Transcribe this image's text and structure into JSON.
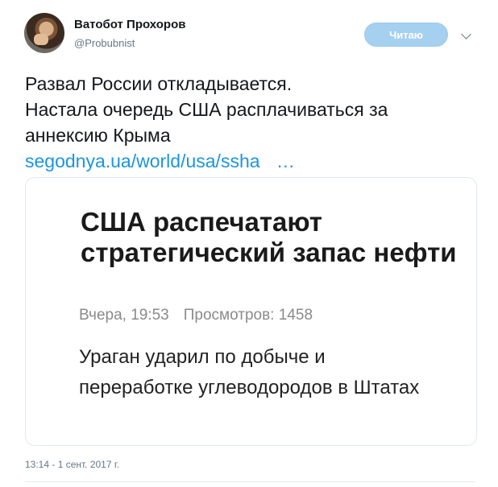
{
  "author": {
    "name": "Ватобот Прохоров",
    "handle": "@Probubnist"
  },
  "follow_button": {
    "label": "Читаю"
  },
  "tweet": {
    "lines": [
      "Развал России откладывается.",
      "Настала очередь США расплачиваться за",
      "аннексию Крыма"
    ],
    "link_text": "segodnya.ua/world/usa/ssha",
    "link_ellipsis": "…",
    "timestamp": "13:14 - 1 сент. 2017 г."
  },
  "card": {
    "title": "США распечатают стратегический запас нефти",
    "date": "Вчера, 19:53",
    "views": "Просмотров: 1458",
    "description": "Ураган ударил по добыче и переработке углеводородов в Штатах"
  },
  "colors": {
    "link": "#1b95e0",
    "follow_button_bg": "#a6d0f0",
    "muted": "#657786"
  }
}
